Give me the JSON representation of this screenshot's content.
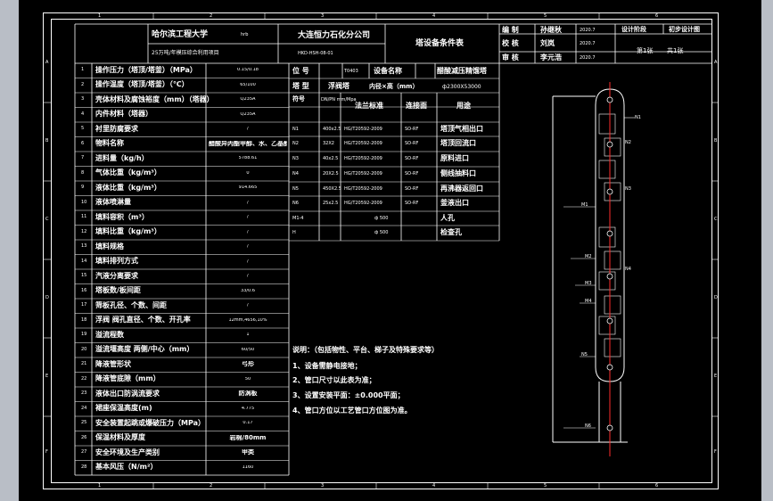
{
  "title_block": {
    "university": "哈尔滨工程大学",
    "university_suffix": "hrb",
    "company": "大连恒力石化分公司",
    "project": "25万吨/年模压综合利用项目",
    "drawing_no": "HKD-HSH-08-01",
    "doc_title": "塔设备条件表",
    "right": {
      "rows": [
        {
          "role": "编 制",
          "name": "孙继秋",
          "date": "2020.7"
        },
        {
          "role": "校 核",
          "name": "刘岚",
          "date": "2020.7"
        },
        {
          "role": "审 核",
          "name": "李元浩",
          "date": "2020.7"
        }
      ],
      "stage_label": "设计阶段",
      "stage_value": "初步设计图",
      "sheet": "第1张",
      "total": "共1张"
    }
  },
  "params": [
    {
      "no": "1",
      "label": "操作压力（塔顶/塔釜）（MPa）",
      "value": "0.15/0.18"
    },
    {
      "no": "2",
      "label": "操作温度（塔顶/塔釜）（℃）",
      "value": "65/100"
    },
    {
      "no": "3",
      "label": "壳体材料及腐蚀裕度（mm）（塔器）",
      "value": "Q235A"
    },
    {
      "no": "4",
      "label": "内件材料（塔器）",
      "value": "Q235A"
    },
    {
      "no": "5",
      "label": "衬里防腐要求",
      "value": "/"
    },
    {
      "no": "6",
      "label": "物料名称",
      "value": "醋酸异丙酯甲醇、水、乙基醇"
    },
    {
      "no": "7",
      "label": "进料量（kg/h）",
      "value": "5788.61"
    },
    {
      "no": "8",
      "label": "气体比重（kg/m³）",
      "value": "0"
    },
    {
      "no": "9",
      "label": "液体比重（kg/m³）",
      "value": "914.665"
    },
    {
      "no": "10",
      "label": "液体喷淋量",
      "value": "/"
    },
    {
      "no": "11",
      "label": "填料容积（m³）",
      "value": "/"
    },
    {
      "no": "12",
      "label": "填料比重（kg/m³）",
      "value": "/"
    },
    {
      "no": "13",
      "label": "填料规格",
      "value": "/"
    },
    {
      "no": "14",
      "label": "填料排列方式",
      "value": "/"
    },
    {
      "no": "15",
      "label": "汽液分离要求",
      "value": "/"
    },
    {
      "no": "16",
      "label": "塔板数/板间距",
      "value": "33/0.6"
    },
    {
      "no": "17",
      "label": "筛板孔径、个数、间距",
      "value": "/"
    },
    {
      "no": "18",
      "label": "浮阀  阀孔直径、个数、开孔率",
      "value": "12mm,4656,10%"
    },
    {
      "no": "19",
      "label": "溢流程数",
      "value": "1"
    },
    {
      "no": "20",
      "label": "溢流堰高度  两侧/中心（mm）",
      "value": "60/50"
    },
    {
      "no": "21",
      "label": "降液管形状",
      "value": "弓形"
    },
    {
      "no": "22",
      "label": "降液管底隙（mm）",
      "value": "50"
    },
    {
      "no": "23",
      "label": "液体出口防涡流要求",
      "value": "防涡板"
    },
    {
      "no": "24",
      "label": "裙座保温高度(m)",
      "value": "4.775"
    },
    {
      "no": "25",
      "label": "安全装置起跳或爆破压力（MPa）",
      "value": "0.17"
    },
    {
      "no": "26",
      "label": "保温材料及厚度",
      "value": "岩棉/80mm"
    },
    {
      "no": "27",
      "label": "安全环境及生产类别",
      "value": "甲类"
    },
    {
      "no": "28",
      "label": "基本风压（N/m²）",
      "value": "1160"
    }
  ],
  "equipment": {
    "position_label": "位  号",
    "position_value": "T0403",
    "name_label": "设备名称",
    "name_value": "醋酸减压精馏塔",
    "type_label": "塔  型",
    "type_value": "浮阀塔",
    "diameter_label": "内径×高（mm）",
    "diameter_value": "ф2300X53000"
  },
  "nozzles": {
    "headers": [
      "符号",
      "DN/PN mm/Mpa",
      "法兰标准",
      "连接面",
      "用途"
    ],
    "rows": [
      {
        "sym": "N1",
        "dn": "400x2.5",
        "std": "HG/T20592-2009",
        "face": "SO-RF",
        "use": "塔顶气相出口"
      },
      {
        "sym": "N2",
        "dn": "32X2",
        "std": "HG/T20592-2009",
        "face": "SO-RF",
        "use": "塔顶回流口"
      },
      {
        "sym": "N3",
        "dn": "40x2.5",
        "std": "HG/T20592-2009",
        "face": "SO-RF",
        "use": "原料进口"
      },
      {
        "sym": "N4",
        "dn": "20X2.5",
        "std": "HG/T20592-2009",
        "face": "SO-RF",
        "use": "侧线抽料口"
      },
      {
        "sym": "N5",
        "dn": "450X2.5",
        "std": "HG/T20592-2009",
        "face": "SO-RF",
        "use": "再沸器返回口"
      },
      {
        "sym": "N6",
        "dn": "25x2.5",
        "std": "HG/T20592-2009",
        "face": "SO-RF",
        "use": "釜液出口"
      },
      {
        "sym": "M1-4",
        "dn": "",
        "std": "ф 500",
        "face": "",
        "use": "人孔"
      },
      {
        "sym": "H",
        "dn": "",
        "std": "ф 500",
        "face": "",
        "use": "检查孔"
      }
    ]
  },
  "notes": {
    "title": "说明：（包括物性、平台、梯子及特殊要求等）",
    "items": [
      "1、设备需静电接地；",
      "2、管口尺寸以此表为准；",
      "3、设置安装平面：±0.000平面；",
      "4、管口方位以工艺管口方位图为准。"
    ]
  },
  "ruler": {
    "cols": [
      "1",
      "2",
      "3",
      "4",
      "5",
      "6",
      "7",
      "8"
    ],
    "rows": [
      "A",
      "B",
      "C",
      "D",
      "E",
      "F"
    ]
  },
  "drawing_labels": [
    "N1",
    "N2",
    "N3",
    "N4",
    "N5",
    "N6",
    "M1",
    "M2",
    "M3",
    "M4"
  ]
}
